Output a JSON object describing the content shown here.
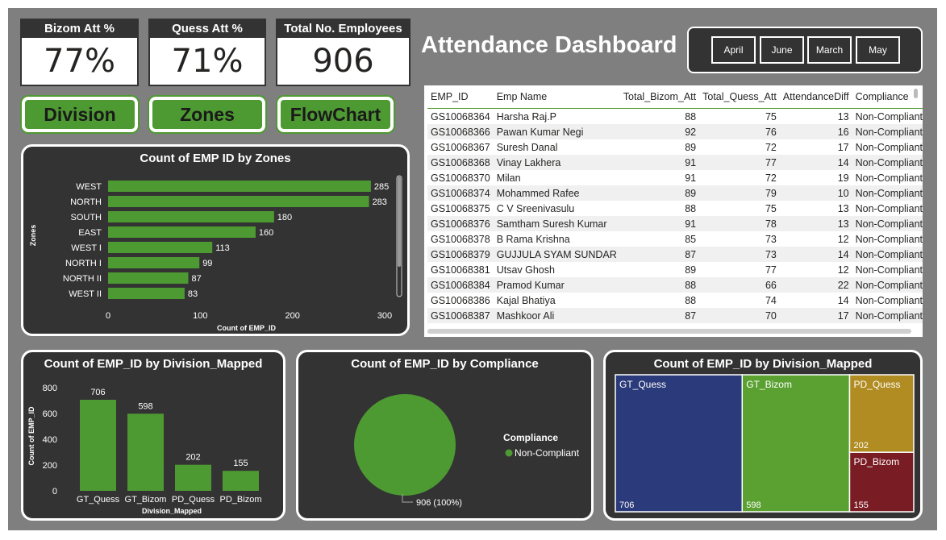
{
  "kpis": [
    {
      "label": "Bizom Att %",
      "value": "77%"
    },
    {
      "label": "Quess Att %",
      "value": "71%"
    },
    {
      "label": "Total No. Employees",
      "value": "906"
    }
  ],
  "nav": {
    "division": "Division",
    "zones": "Zones",
    "flowchart": "FlowChart"
  },
  "dashboard_title": "Attendance Dashboard",
  "months": [
    "April",
    "June",
    "March",
    "May"
  ],
  "table": {
    "columns": [
      "EMP_ID",
      "Emp Name",
      "Total_Bizom_Att",
      "Total_Quess_Att",
      "AttendanceDiff",
      "Compliance"
    ],
    "rows": [
      [
        "GS10068364",
        "Harsha Raj.P",
        "88",
        "75",
        "13",
        "Non-Compliant"
      ],
      [
        "GS10068366",
        "Pawan Kumar Negi",
        "92",
        "76",
        "16",
        "Non-Compliant"
      ],
      [
        "GS10068367",
        "Suresh Danal",
        "89",
        "72",
        "17",
        "Non-Compliant"
      ],
      [
        "GS10068368",
        "Vinay Lakhera",
        "91",
        "77",
        "14",
        "Non-Compliant"
      ],
      [
        "GS10068370",
        "Milan",
        "91",
        "72",
        "19",
        "Non-Compliant"
      ],
      [
        "GS10068374",
        "Mohammed Rafee",
        "89",
        "79",
        "10",
        "Non-Compliant"
      ],
      [
        "GS10068375",
        "C V Sreenivasulu",
        "88",
        "75",
        "13",
        "Non-Compliant"
      ],
      [
        "GS10068376",
        "Samtham Suresh Kumar",
        "91",
        "78",
        "13",
        "Non-Compliant"
      ],
      [
        "GS10068378",
        "B Rama Krishna",
        "85",
        "73",
        "12",
        "Non-Compliant"
      ],
      [
        "GS10068379",
        "GUJJULA SYAM SUNDAR",
        "87",
        "73",
        "14",
        "Non-Compliant"
      ],
      [
        "GS10068381",
        "Utsav Ghosh",
        "89",
        "77",
        "12",
        "Non-Compliant"
      ],
      [
        "GS10068384",
        "Pramod Kumar",
        "88",
        "66",
        "22",
        "Non-Compliant"
      ],
      [
        "GS10068386",
        "Kajal Bhatiya",
        "88",
        "74",
        "14",
        "Non-Compliant"
      ],
      [
        "GS10068387",
        "Mashkoor Ali",
        "87",
        "70",
        "17",
        "Non-Compliant"
      ]
    ]
  },
  "chart_data": [
    {
      "type": "bar",
      "orientation": "horizontal",
      "title": "Count of EMP ID by Zones",
      "xlabel": "Count of EMP_ID",
      "ylabel": "Zones",
      "categories": [
        "WEST",
        "NORTH",
        "SOUTH",
        "EAST",
        "WEST I",
        "NORTH I",
        "NORTH II",
        "WEST II"
      ],
      "values": [
        285,
        283,
        180,
        160,
        113,
        99,
        87,
        83
      ],
      "xticks": [
        "0",
        "100",
        "200",
        "300"
      ],
      "xlim": [
        0,
        300
      ],
      "color": "#4e9a32"
    },
    {
      "type": "bar",
      "title": "Count of EMP_ID by Division_Mapped",
      "xlabel": "Division_Mapped",
      "ylabel": "Count of EMP_ID",
      "categories": [
        "GT_Quess",
        "GT_Bizom",
        "PD_Quess",
        "PD_Bizom"
      ],
      "values": [
        706,
        598,
        202,
        155
      ],
      "yticks": [
        "0",
        "200",
        "400",
        "600",
        "800"
      ],
      "ylim": [
        0,
        800
      ],
      "color": "#4e9a32"
    },
    {
      "type": "pie",
      "title": "Count of EMP_ID by Compliance",
      "legend_title": "Compliance",
      "slices": [
        {
          "name": "Non-Compliant",
          "value": 906,
          "label": "906 (100%)"
        }
      ],
      "color": "#4e9a32"
    },
    {
      "type": "treemap",
      "title": "Count of EMP_ID by Division_Mapped",
      "items": [
        {
          "name": "GT_Quess",
          "value": 706,
          "color": "#2b3a7a"
        },
        {
          "name": "GT_Bizom",
          "value": 598,
          "color": "#5aa132"
        },
        {
          "name": "PD_Quess",
          "value": 202,
          "color": "#b08c22"
        },
        {
          "name": "PD_Bizom",
          "value": 155,
          "color": "#7a1c24"
        }
      ]
    }
  ]
}
